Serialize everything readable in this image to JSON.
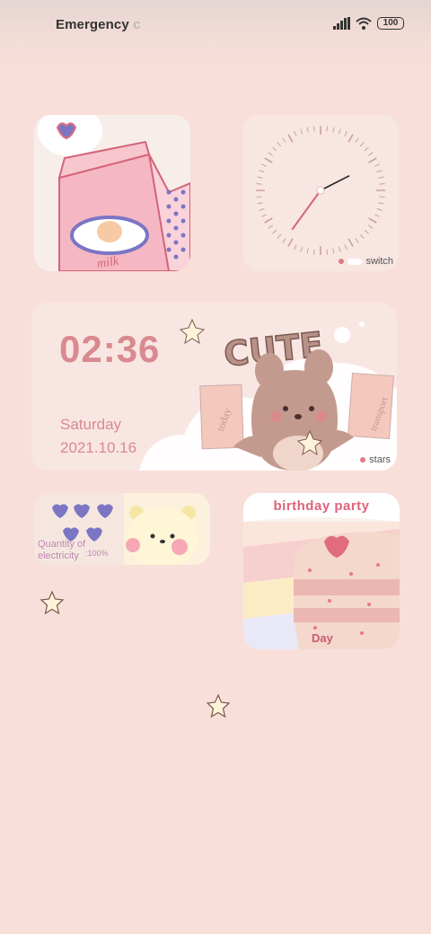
{
  "status_bar": {
    "carrier": "Emergency",
    "carrier_faded": "c",
    "battery": "100"
  },
  "clock_widget": {
    "label": "switch",
    "hour_hand_deg": 63,
    "minute_hand_deg": 216
  },
  "time_widget": {
    "time": "02:36",
    "day": "Saturday",
    "date": "2021.10.16",
    "label": "stars",
    "sticker_title": "CUTE",
    "card_left": "today",
    "card_right": "transport"
  },
  "milk_widget": {
    "carton_text": "milk"
  },
  "battery_widget": {
    "label_line1": "Quantity of",
    "label_line2": "electricity",
    "percent": ":100%"
  },
  "birthday_widget": {
    "title": "birthday party",
    "subtitle": "Day"
  },
  "colors": {
    "accent": "#d98a8e",
    "background": "#f9dfda",
    "heart": "#7b75c4"
  }
}
